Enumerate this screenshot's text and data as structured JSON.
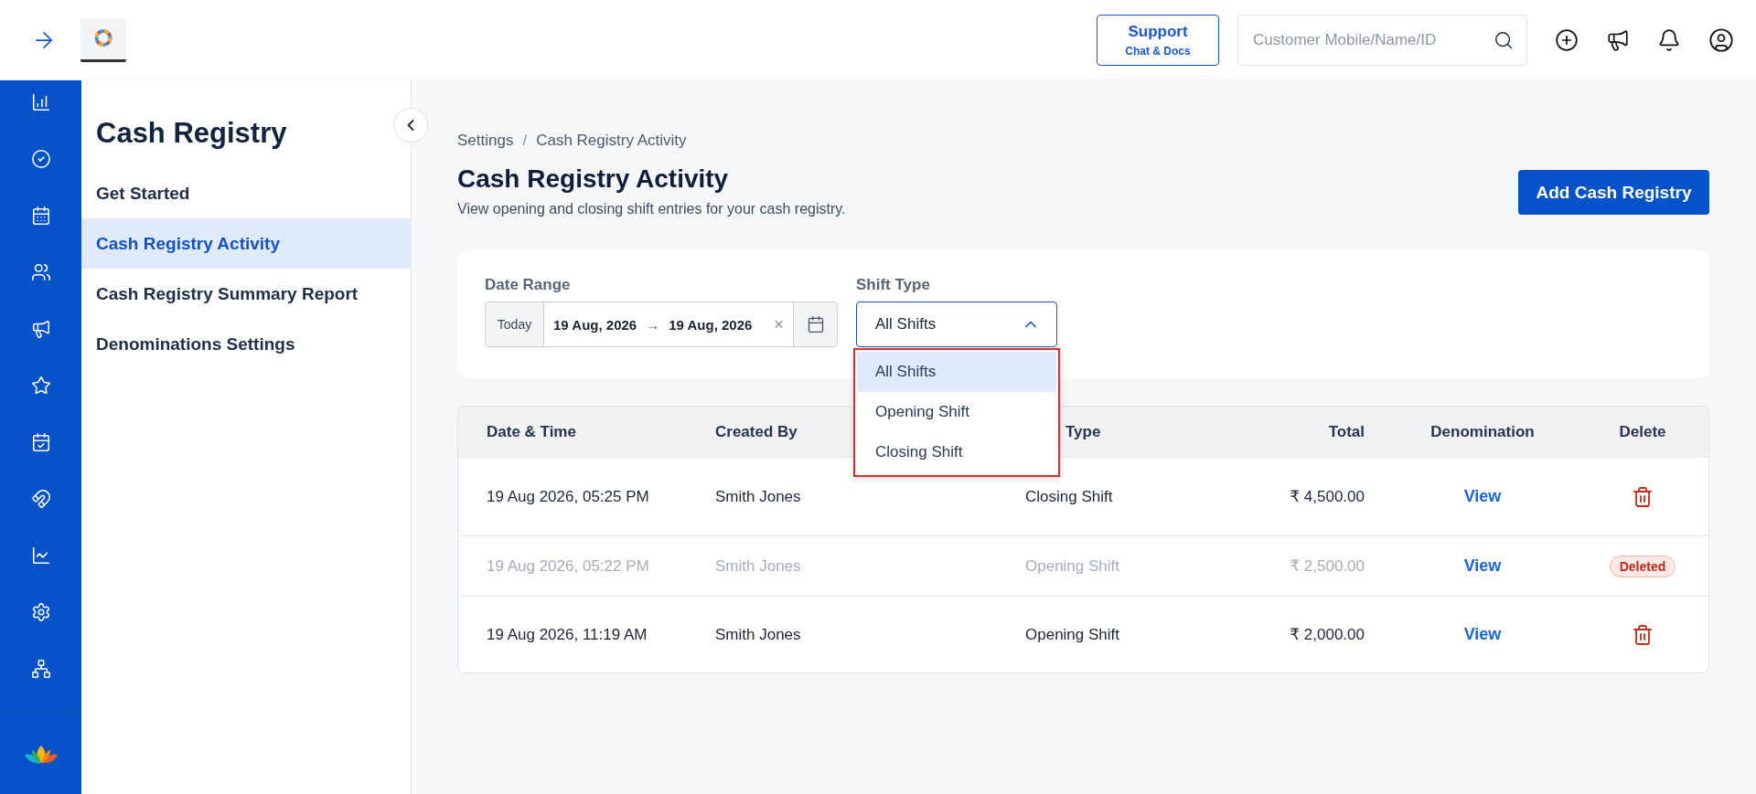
{
  "topbar": {
    "support": {
      "title": "Support",
      "subtitle": "Chat & Docs"
    },
    "search": {
      "placeholder": "Customer Mobile/Name/ID"
    }
  },
  "sidebar": {
    "title": "Cash Registry",
    "items": [
      {
        "label": "Get Started",
        "selected": false
      },
      {
        "label": "Cash Registry Activity",
        "selected": true
      },
      {
        "label": "Cash Registry Summary Report",
        "selected": false
      },
      {
        "label": "Denominations Settings",
        "selected": false
      }
    ]
  },
  "breadcrumb": {
    "separator": "/",
    "items": [
      "Settings",
      "Cash Registry Activity"
    ]
  },
  "page": {
    "title": "Cash Registry Activity",
    "subtitle": "View opening and closing shift entries for your cash registry.",
    "action": "Add Cash Registry"
  },
  "filters": {
    "date_range": {
      "label": "Date Range",
      "preset": "Today",
      "start": "19 Aug, 2026",
      "separator": "→",
      "end": "19 Aug, 2026",
      "clear": "×"
    },
    "shift_type": {
      "label": "Shift Type",
      "value": "All Shifts",
      "expanded": true,
      "options": [
        {
          "label": "All Shifts",
          "selected": true
        },
        {
          "label": "Opening Shift",
          "selected": false
        },
        {
          "label": "Closing Shift",
          "selected": false
        }
      ]
    }
  },
  "table": {
    "columns": [
      "Date & Time",
      "Created By",
      "Type",
      "Total",
      "Denomination",
      "Delete"
    ],
    "rows": [
      {
        "date_time": "19 Aug 2026, 05:25 PM",
        "created_by": "Smith Jones",
        "shift_type": "Closing Shift",
        "total": "₹ 4,500.00",
        "denomination": "View",
        "deleted": false
      },
      {
        "date_time": "19 Aug 2026, 05:22 PM",
        "created_by": "Smith Jones",
        "shift_type": "Opening Shift",
        "total": "₹ 2,500.00",
        "denomination": "View",
        "deleted": true,
        "status_badge": "Deleted"
      },
      {
        "date_time": "19 Aug 2026, 11:19 AM",
        "created_by": "Smith Jones",
        "shift_type": "Opening Shift",
        "total": "₹ 2,000.00",
        "denomination": "View",
        "deleted": false
      }
    ]
  }
}
